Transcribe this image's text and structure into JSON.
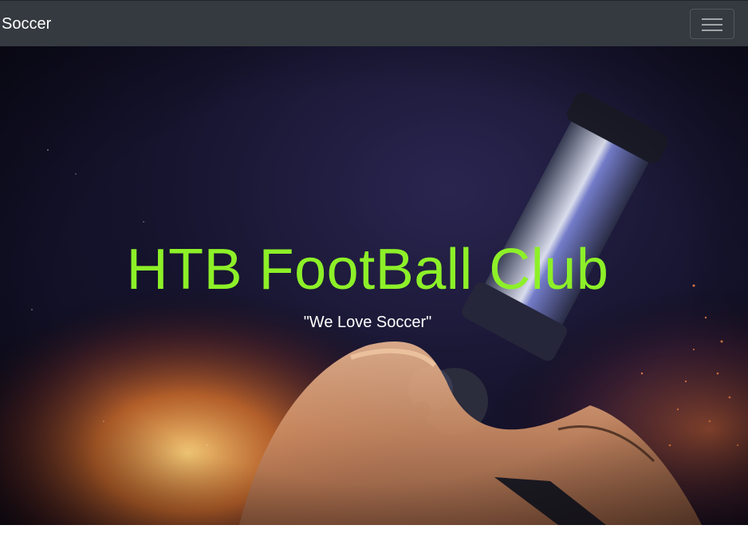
{
  "navbar": {
    "brand": "Soccer",
    "toggle_icon": "hamburger-menu-icon"
  },
  "hero": {
    "title": "HTB FootBall Club",
    "subtitle": "\"We Love Soccer\"",
    "background_image": "soccer-cleat-on-fire",
    "title_color": "#8df028"
  }
}
